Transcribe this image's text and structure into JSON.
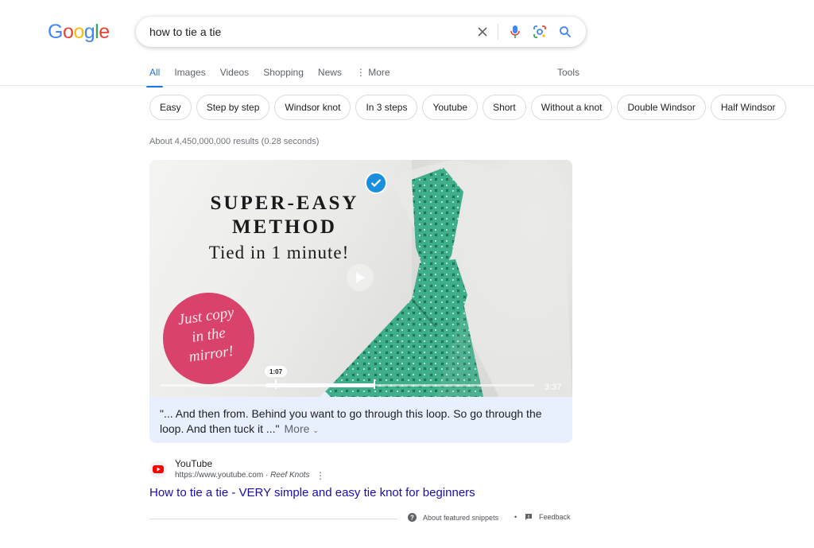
{
  "logo": {
    "letters": [
      "G",
      "o",
      "o",
      "g",
      "l",
      "e"
    ]
  },
  "search": {
    "query": "how to tie a tie"
  },
  "tabs": [
    {
      "label": "All",
      "active": true
    },
    {
      "label": "Images"
    },
    {
      "label": "Videos"
    },
    {
      "label": "Shopping"
    },
    {
      "label": "News"
    },
    {
      "label": "More"
    }
  ],
  "tools_label": "Tools",
  "chips": [
    "Easy",
    "Step by step",
    "Windsor knot",
    "In 3 steps",
    "Youtube",
    "Short",
    "Without a knot",
    "Double Windsor",
    "Half Windsor"
  ],
  "stats": "About 4,450,000,000 results (0.28 seconds)",
  "video": {
    "headline1": "SUPER-EASY",
    "headline2": "METHOD",
    "subhead": "Tied in 1 minute!",
    "circle_line1": "Just copy",
    "circle_line2": "in the",
    "circle_line3": "mirror!",
    "current_time": "1:07",
    "duration": "3:37"
  },
  "snippet": {
    "text": "\"... And then from. Behind you want to go through this loop. So go through the loop. And then tuck it ...\"",
    "more_label": "More"
  },
  "result": {
    "source_name": "YouTube",
    "url": "https://www.youtube.com",
    "url_sep": " · ",
    "channel": "Reef Knots",
    "title": "How to tie a tie - VERY simple and easy tie knot for beginners"
  },
  "footer": {
    "about_label": "About featured snippets",
    "separator": "•",
    "feedback_label": "Feedback"
  },
  "colors": {
    "accent": "#1a73e8",
    "link": "#1a0dab",
    "tie": "#3fae8a",
    "circle": "#d9426a"
  }
}
